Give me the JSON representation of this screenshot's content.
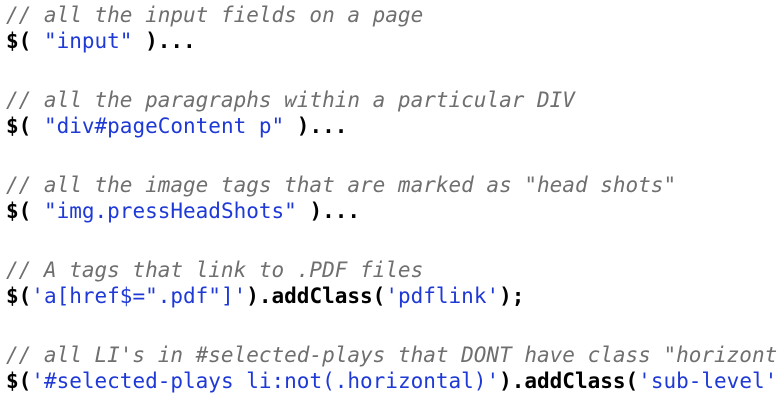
{
  "blocks": [
    {
      "comment": "// all the input fields on a page",
      "code": {
        "prefix": "$( ",
        "arg": "\"input\"",
        "suffix": " )..."
      }
    },
    {
      "comment": "// all the paragraphs within a particular DIV",
      "code": {
        "prefix": "$( ",
        "arg": "\"div#pageContent p\"",
        "suffix": " )..."
      }
    },
    {
      "comment": "// all the image tags that are marked as \"head shots\"",
      "code": {
        "prefix": "$( ",
        "arg": "\"img.pressHeadShots\"",
        "suffix": " )..."
      }
    },
    {
      "comment": "// A tags that link to .PDF files",
      "code": {
        "prefix": "$(",
        "arg": "'a[href$=\".pdf\"]'",
        "middle": ").addClass(",
        "arg2": "'pdflink'",
        "suffix": ");"
      }
    },
    {
      "comment": "// all LI's in #selected-plays that DONT have class \"horizontal\"",
      "code": {
        "prefix": "$(",
        "arg": "'#selected-plays li:not(.horizontal)'",
        "middle": ").addClass(",
        "arg2": "'sub-level'",
        "suffix": ");"
      }
    }
  ],
  "colors": {
    "comment": "#6f6f6f",
    "string": "#1f39d6",
    "code": "#000000",
    "background": "#ffffff"
  }
}
